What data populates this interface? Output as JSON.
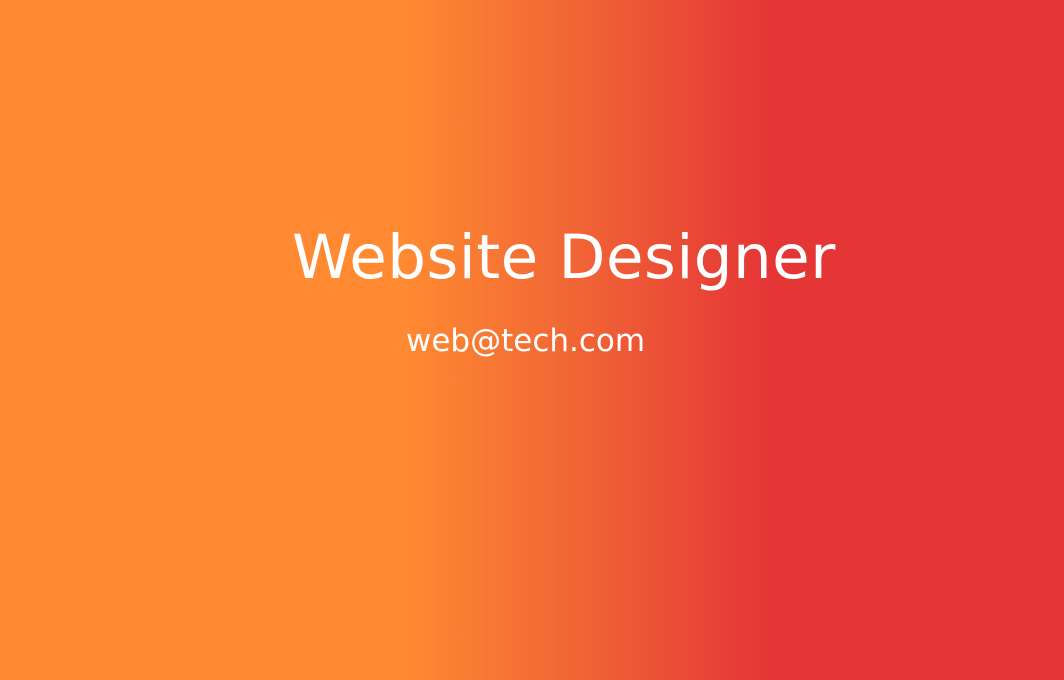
{
  "card": {
    "title": "Website Designer",
    "email": "web@tech.com"
  },
  "colors": {
    "gradient_start": "#ff8a31",
    "gradient_end": "#e53636",
    "text": "#ffffff"
  }
}
